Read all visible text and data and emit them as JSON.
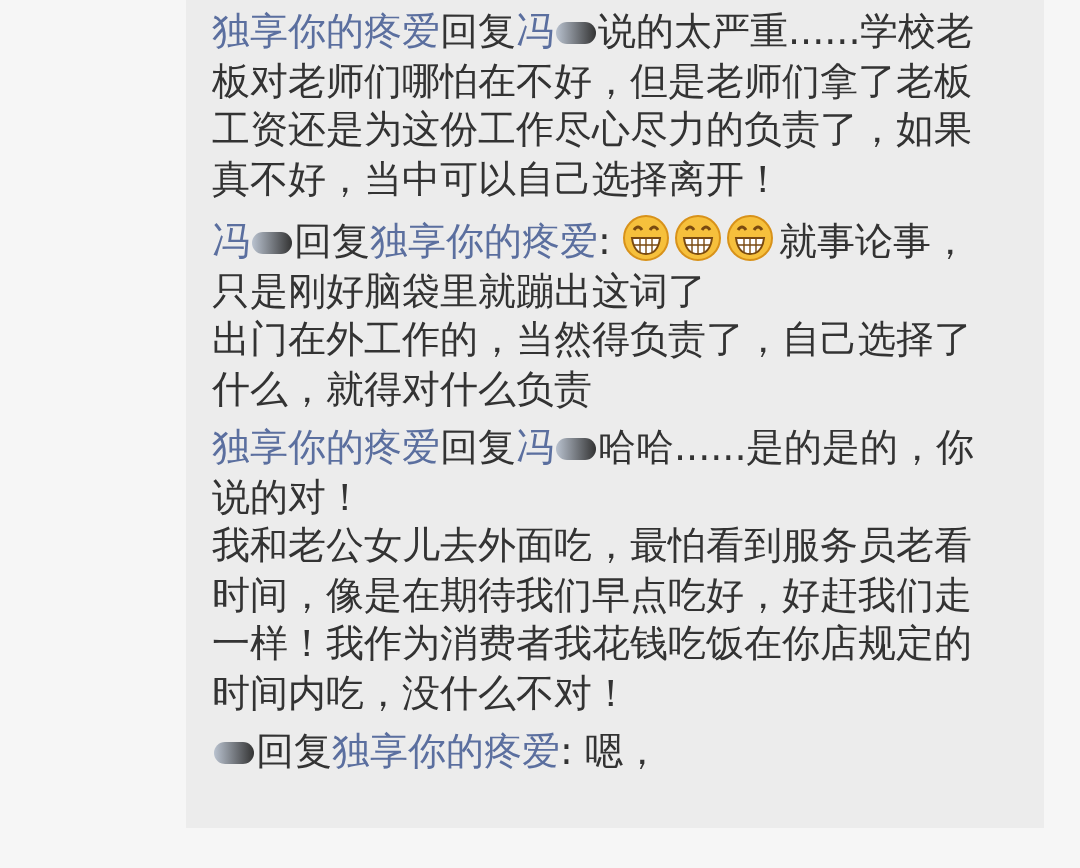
{
  "comments": [
    {
      "segments": [
        {
          "kind": "user",
          "text": "独享你的疼爱"
        },
        {
          "kind": "text",
          "text": "回复"
        },
        {
          "kind": "user",
          "text": "冯"
        },
        {
          "kind": "redacted"
        },
        {
          "kind": "text",
          "text": "说的太严重......学校老板对老师们哪怕在不好，但是老师们拿了老板工资还是为这份工作尽心尽力的负责了，如果真不好，当中可以自己选择离开！"
        }
      ]
    },
    {
      "segments": [
        {
          "kind": "user",
          "text": "冯"
        },
        {
          "kind": "redacted"
        },
        {
          "kind": "text",
          "text": "回复"
        },
        {
          "kind": "user",
          "text": "独享你的疼爱"
        },
        {
          "kind": "text",
          "text": ": "
        },
        {
          "kind": "emoji"
        },
        {
          "kind": "emoji"
        },
        {
          "kind": "emoji"
        },
        {
          "kind": "text",
          "text": "就事论事，只是刚好脑袋里就蹦出这词了"
        },
        {
          "kind": "break"
        },
        {
          "kind": "text",
          "text": "出门在外工作的，当然得负责了，自己选择了什么，就得对什么负责"
        }
      ]
    },
    {
      "segments": [
        {
          "kind": "user",
          "text": "独享你的疼爱"
        },
        {
          "kind": "text",
          "text": "回复"
        },
        {
          "kind": "user",
          "text": "冯"
        },
        {
          "kind": "redacted"
        },
        {
          "kind": "text",
          "text": "哈哈......是的是的，你说的对！"
        },
        {
          "kind": "break"
        },
        {
          "kind": "text",
          "text": "我和老公女儿去外面吃，最怕看到服务员老看时间，像是在期待我们早点吃好，好赶我们走一样！我作为消费者我花钱吃饭在你店规定的时间内吃，没什么不对！"
        }
      ]
    },
    {
      "segments": [
        {
          "kind": "redacted"
        },
        {
          "kind": "text",
          "text": "回复"
        },
        {
          "kind": "user",
          "text": "独享你的疼爱"
        },
        {
          "kind": "text",
          "text": ": 嗯，"
        }
      ]
    }
  ]
}
